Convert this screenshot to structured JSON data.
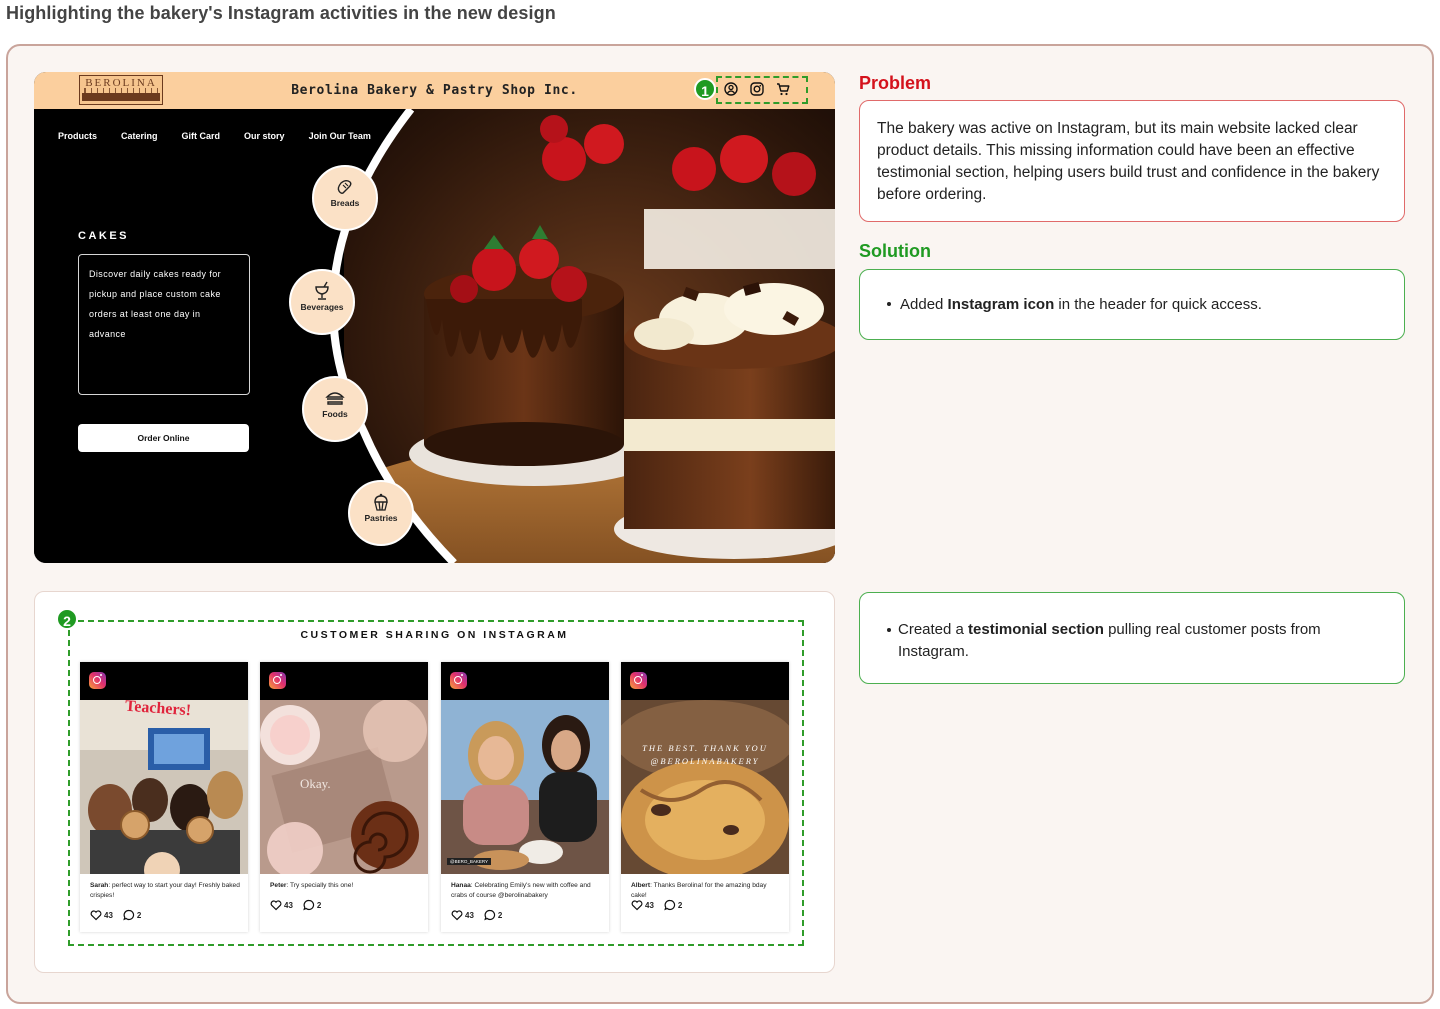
{
  "page_title": "Highlighting the bakery's Instagram activities in the new design",
  "site": {
    "logo_text": "BEROLINA",
    "shop_name": "Berolina Bakery & Pastry Shop Inc.",
    "badge": "1",
    "nav": [
      "Products",
      "Catering",
      "Gift Card",
      "Our story",
      "Join Our Team"
    ],
    "hero_heading": "CAKES",
    "hero_text": "Discover daily cakes ready for pickup and place custom cake orders at least one day in advance",
    "order_button": "Order Online",
    "categories": [
      {
        "label": "Breads",
        "icon": "bread-icon"
      },
      {
        "label": "Beverages",
        "icon": "beverage-icon"
      },
      {
        "label": "Foods",
        "icon": "sandwich-icon"
      },
      {
        "label": "Pastries",
        "icon": "cupcake-icon"
      }
    ],
    "header_icons": [
      "user-icon",
      "instagram-icon",
      "cart-icon"
    ]
  },
  "problem": {
    "heading": "Problem",
    "text": "The bakery was active on Instagram, but its main website lacked clear product details. This missing information could have been an effective testimonial section, helping users build trust and confidence in the bakery before ordering."
  },
  "solution": {
    "heading": "Solution",
    "item1_pre": "Added ",
    "item1_bold": "Instagram icon",
    "item1_post": " in the header for quick access.",
    "item2_pre": "Created a ",
    "item2_bold": "testimonial section",
    "item2_post": " pulling real customer posts from Instagram."
  },
  "instagram": {
    "badge": "2",
    "title": "CUSTOMER SHARING ON INSTAGRAM",
    "posts": [
      {
        "name": "Sarah",
        "caption": ": perfect way to start your day! Freshly baked crispies!",
        "likes": "43",
        "comments": "2",
        "image_text": "Teachers!"
      },
      {
        "name": "Peter",
        "caption": ": Try specially this one!",
        "likes": "43",
        "comments": "2",
        "image_text": "Okay."
      },
      {
        "name": "Hanaa",
        "caption": ": Celebrating Emily's new with coffee and crabs of course @berolinabakery",
        "likes": "43",
        "comments": "2",
        "image_text": "@BERO_BAKERY"
      },
      {
        "name": "Albert",
        "caption": ": Thanks Berolina! for the amazing bday cake!",
        "likes": "43",
        "comments": "2",
        "image_text": "THE BEST. THANK YOU @BEROLINABAKERY"
      }
    ]
  },
  "colors": {
    "header": "#fbcf9e",
    "accent_green": "#1f9a22",
    "problem_red": "#d4121c",
    "frame": "#c9a49b"
  }
}
